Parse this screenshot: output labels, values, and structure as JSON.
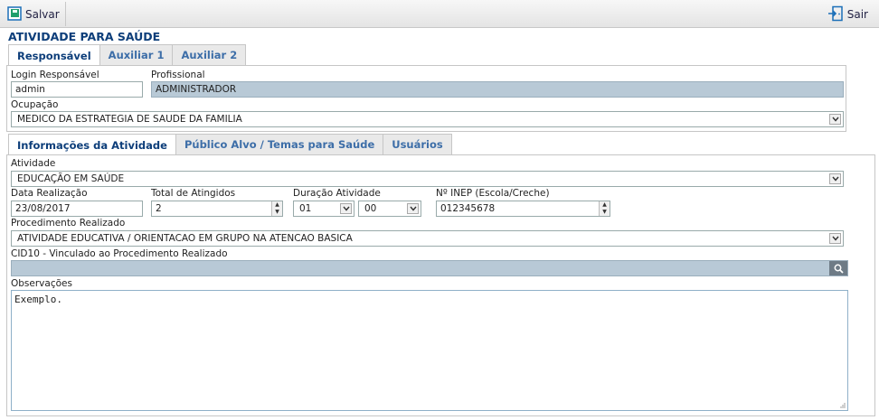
{
  "toolbar": {
    "save_label": "Salvar",
    "exit_label": "Sair"
  },
  "page_title": "ATIVIDADE PARA SAÚDE",
  "top_tabs": [
    {
      "label": "Responsável",
      "active": true
    },
    {
      "label": "Auxiliar 1",
      "active": false
    },
    {
      "label": "Auxiliar 2",
      "active": false
    }
  ],
  "responsavel": {
    "login_label": "Login Responsável",
    "login_value": "admin",
    "profissional_label": "Profissional",
    "profissional_value": "ADMINISTRADOR",
    "ocupacao_label": "Ocupação",
    "ocupacao_value": "MEDICO DA ESTRATEGIA DE SAUDE DA FAMILIA"
  },
  "sub_tabs": [
    {
      "label": "Informações da Atividade",
      "active": true
    },
    {
      "label": "Público Alvo / Temas para Saúde",
      "active": false
    },
    {
      "label": "Usuários",
      "active": false
    }
  ],
  "atividade": {
    "atividade_label": "Atividade",
    "atividade_value": "EDUCAÇÃO EM SAÚDE",
    "data_label": "Data Realização",
    "data_value": "23/08/2017",
    "total_label": "Total de Atingidos",
    "total_value": "2",
    "duracao_label": "Duração Atividade",
    "duracao_hours": "01",
    "duracao_minutes": "00",
    "inep_label": "Nº INEP (Escola/Creche)",
    "inep_value": "012345678",
    "procedimento_label": "Procedimento Realizado",
    "procedimento_value": "ATIVIDADE EDUCATIVA / ORIENTACAO EM GRUPO NA ATENCAO BASICA",
    "cid_label": "CID10 - Vinculado ao Procedimento Realizado",
    "cid_value": "",
    "obs_label": "Observações",
    "obs_value": "Exemplo."
  },
  "colors": {
    "title": "#0d3e7a",
    "tab_text": "#3d6ea8",
    "readonly_bg": "#b8c9d6",
    "save_icon": "#1e9e6a",
    "exit_icon": "#1b6fb8"
  },
  "icons": {
    "save": "save-icon",
    "exit": "exit-door-icon",
    "search": "search-icon",
    "dropdown": "chevron-down-icon"
  }
}
